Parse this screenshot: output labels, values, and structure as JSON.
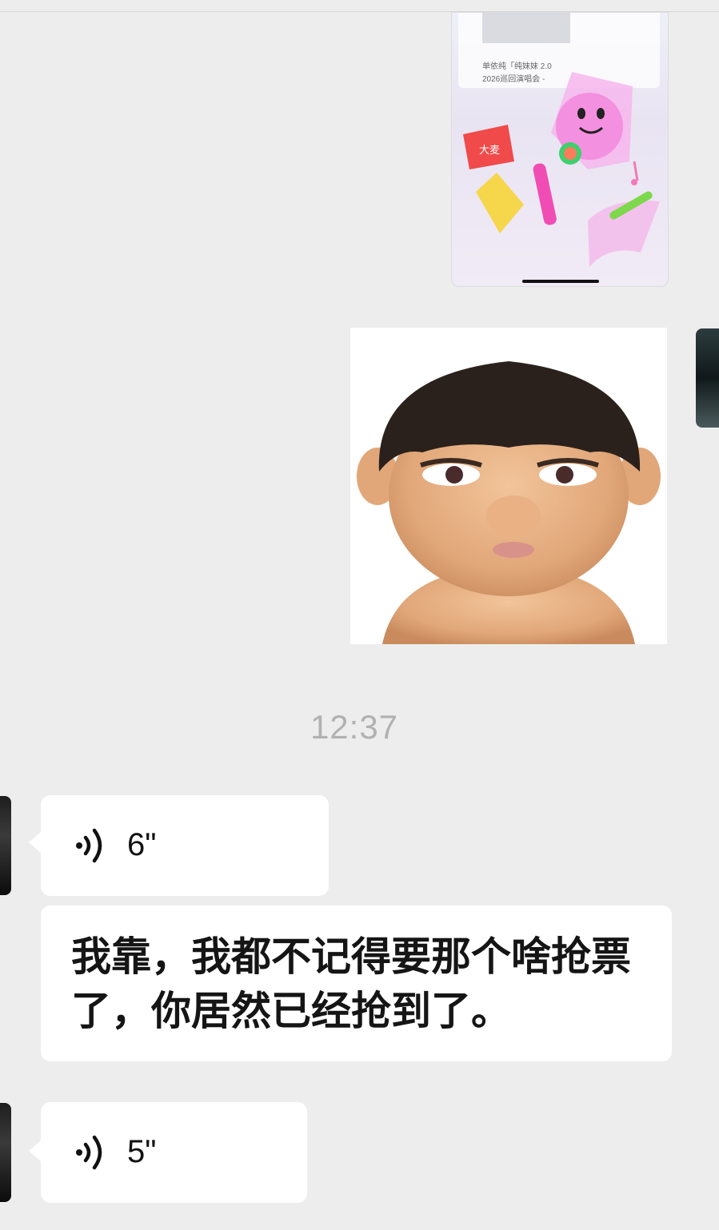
{
  "chat": {
    "shared_image_card": {
      "line1": "单依纯「纯妹妹 2.0",
      "line2": "2026巡回演唱会 -",
      "badge": "大麦"
    },
    "timestamp": "12:37",
    "messages": [
      {
        "type": "voice",
        "duration": "6\""
      },
      {
        "type": "text",
        "text": "我靠，我都不记得要那个啥抢票了，你居然已经抢到了。"
      },
      {
        "type": "voice",
        "duration": "5\""
      }
    ]
  },
  "colors": {
    "background": "#ededed",
    "bubble": "#ffffff",
    "timestamp": "#b1b1b1",
    "text": "#151515"
  },
  "icons": {
    "voice": "voice-wave-icon"
  }
}
